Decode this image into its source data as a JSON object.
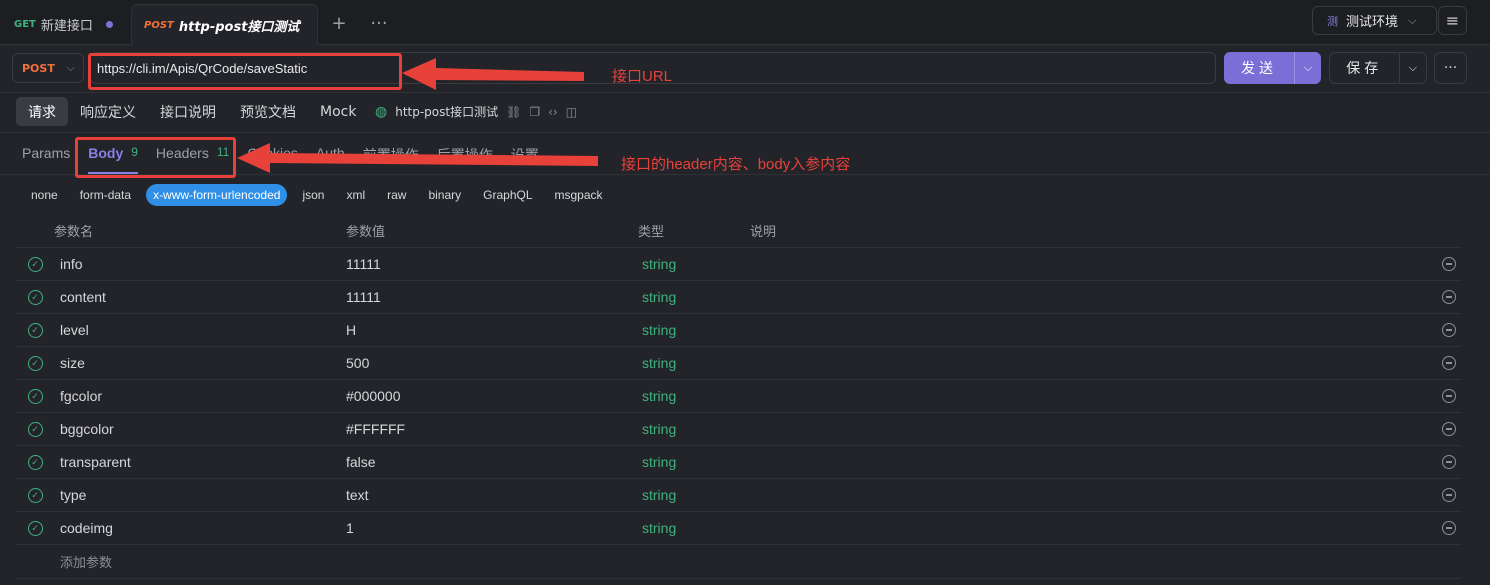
{
  "tabs": [
    {
      "method": "GET",
      "label": "新建接口"
    },
    {
      "method": "POST",
      "label": "http-post接口测试"
    }
  ],
  "env": {
    "badge": "测",
    "label": "测试环境"
  },
  "request": {
    "method": "POST",
    "url": "https://cli.im/Apis/QrCode/saveStatic",
    "send_label": "发送",
    "save_label": "保存"
  },
  "section_tabs": [
    "请求",
    "响应定义",
    "接口说明",
    "预览文档",
    "Mock"
  ],
  "doc_title": "http-post接口测试",
  "sub_tabs": [
    {
      "label": "Params",
      "badge": ""
    },
    {
      "label": "Body",
      "badge": "9"
    },
    {
      "label": "Headers",
      "badge": "11"
    },
    {
      "label": "Cookies",
      "badge": ""
    },
    {
      "label": "Auth",
      "badge": ""
    },
    {
      "label": "前置操作",
      "badge": ""
    },
    {
      "label": "后置操作",
      "badge": ""
    },
    {
      "label": "设置",
      "badge": ""
    }
  ],
  "body_types": [
    "none",
    "form-data",
    "x-www-form-urlencoded",
    "json",
    "xml",
    "raw",
    "binary",
    "GraphQL",
    "msgpack"
  ],
  "table": {
    "headers": {
      "name": "参数名",
      "value": "参数值",
      "type": "类型",
      "desc": "说明"
    },
    "rows": [
      {
        "name": "info",
        "value": "11111",
        "type": "string"
      },
      {
        "name": "content",
        "value": "11111",
        "type": "string"
      },
      {
        "name": "level",
        "value": "H",
        "type": "string"
      },
      {
        "name": "size",
        "value": "500",
        "type": "string"
      },
      {
        "name": "fgcolor",
        "value": "#000000",
        "type": "string"
      },
      {
        "name": "bggcolor",
        "value": "#FFFFFF",
        "type": "string"
      },
      {
        "name": "transparent",
        "value": "false",
        "type": "string"
      },
      {
        "name": "type",
        "value": "text",
        "type": "string"
      },
      {
        "name": "codeimg",
        "value": "1",
        "type": "string"
      }
    ],
    "add_label": "添加参数"
  },
  "annotations": {
    "url_note": "接口URL",
    "body_note": "接口的header内容、body入参内容"
  },
  "colors": {
    "accent": "#7b6ed6",
    "post": "#f0703a",
    "get": "#3fb27f",
    "annotation": "#e8413a",
    "active_type": "#2f8fe6"
  }
}
